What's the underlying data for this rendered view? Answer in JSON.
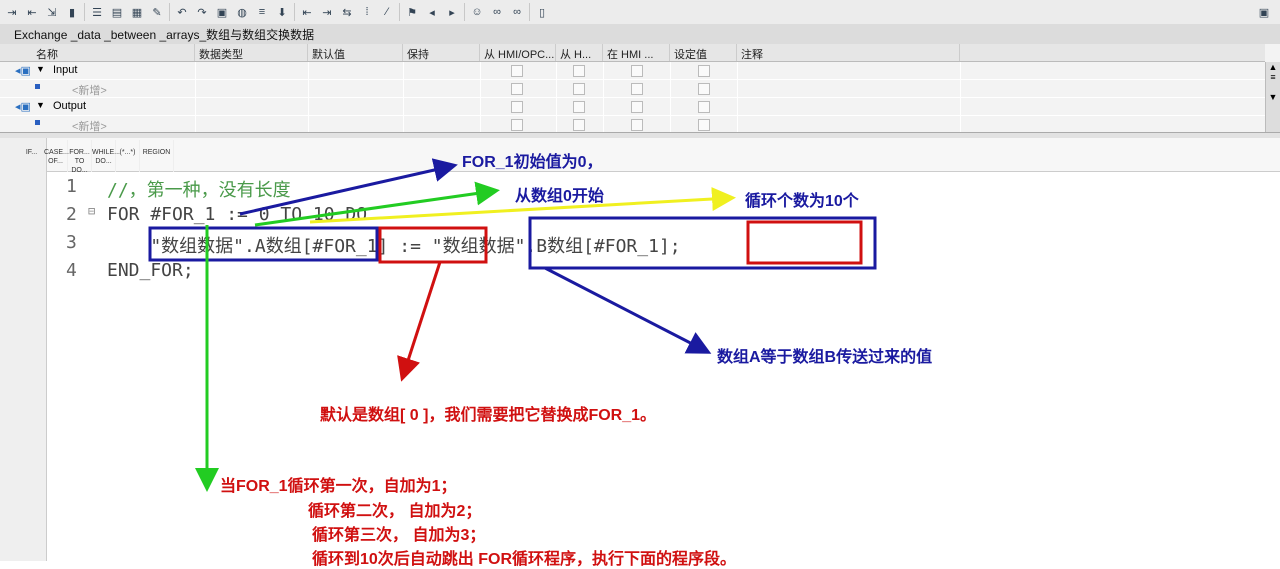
{
  "toolbar": {
    "icons": [
      "insert-row-icon",
      "add-row-icon",
      "insert-block-icon",
      "block-icon",
      "list-icon",
      "collapse-icon",
      "expand-icon",
      "note-icon",
      "goto-icon",
      "network-icon",
      "compile-icon",
      "monitor-icon",
      "filter-icon",
      "download-icon",
      "indent-icon",
      "outdent-icon",
      "split-icon",
      "comment-icon",
      "uncomment-icon",
      "bookmark-icon",
      "prev-bookmark-icon",
      "next-bookmark-icon",
      "user-icon",
      "glasses-icon",
      "glasses2-icon",
      "lock-icon"
    ]
  },
  "title": "Exchange _data _between _arrays_数组与数组交换数据",
  "table": {
    "headers": [
      "名称",
      "数据类型",
      "默认值",
      "保持",
      "从 HMI/OPC...",
      "从 H...",
      "在 HMI ...",
      "设定值",
      "注释"
    ],
    "rows": [
      {
        "name": "Input",
        "type": "section"
      },
      {
        "name": "<新增>",
        "type": "add"
      },
      {
        "name": "Output",
        "type": "section"
      },
      {
        "name": "<新增>",
        "type": "add"
      }
    ]
  },
  "snippets": [
    "IF...",
    "CASE... OF...",
    "FOR... TO DO...",
    "WHILE... DO...",
    "(*...*)",
    "REGION"
  ],
  "code": {
    "line_numbers": [
      "1",
      "2",
      "3",
      "4"
    ],
    "lines": [
      "//，第一种，没有长度",
      "FOR #FOR_1 := 0 TO 10 DO",
      "    \"数组数据\".A数组[#FOR_1] := \"数组数据\".B数组[#FOR_1];",
      "END_FOR;"
    ]
  },
  "annotations": {
    "init": "FOR_1初始值为0，",
    "start": "从数组0开始",
    "count": "循环个数为10个",
    "assign": "数组A等于数组B传送过来的值",
    "default": "默认是数组[ 0 ]，我们需要把它替换成FOR_1。",
    "loop": [
      "当FOR_1循环第一次，自加为1；",
      "循环第二次， 自加为2；",
      "循环第三次， 自加为3；",
      "循环到10次后自动跳出 FOR循环程序，执行下面的程序段。"
    ]
  },
  "colors": {
    "blue": "#1a1aa0",
    "red": "#d01010",
    "green": "#22cc22",
    "yellow": "#f0f020"
  }
}
